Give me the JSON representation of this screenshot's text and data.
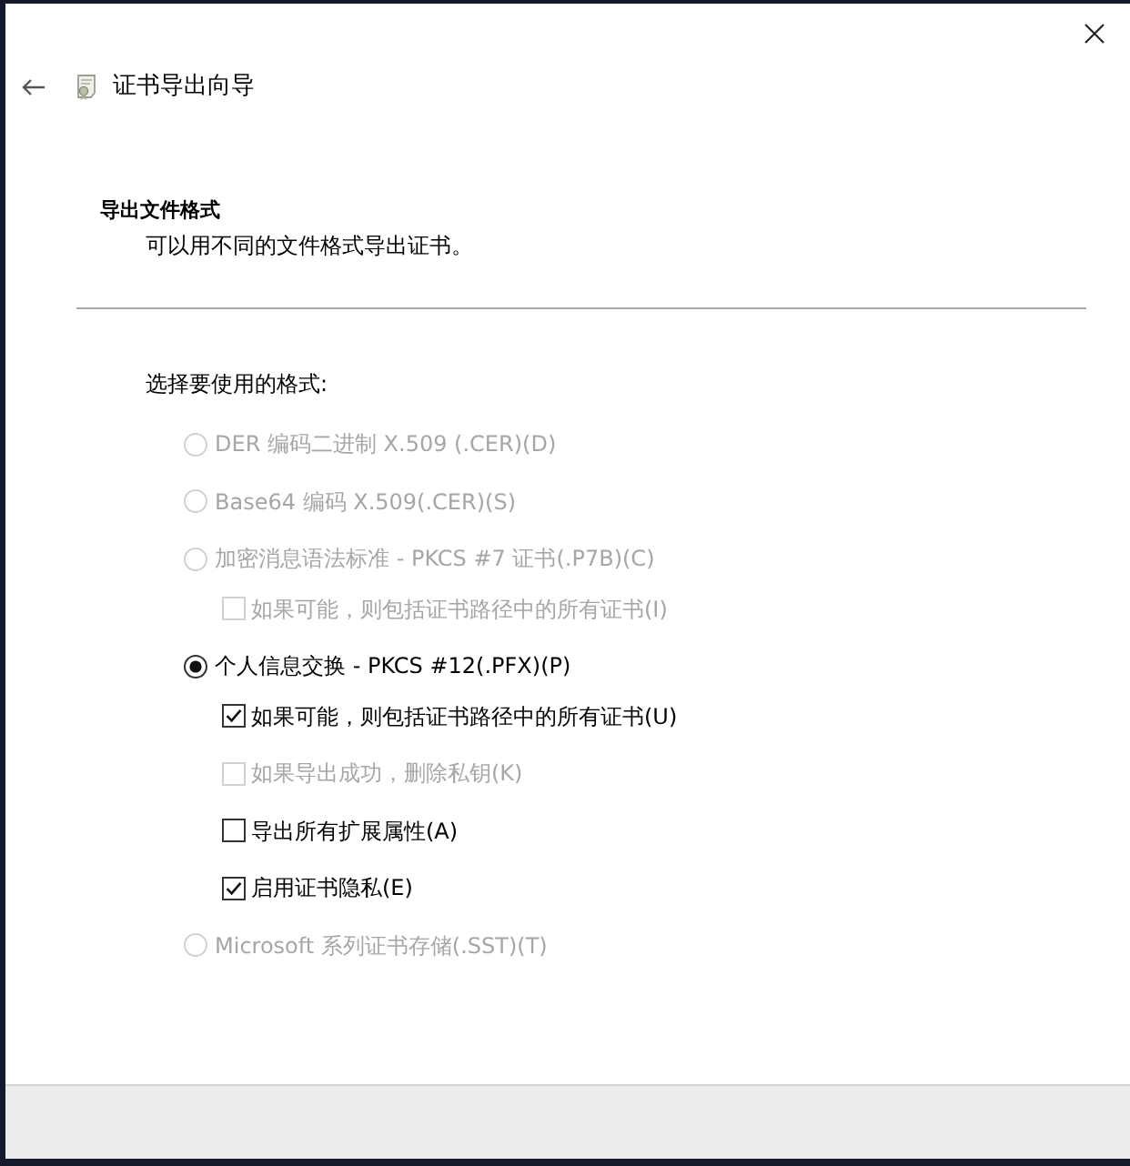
{
  "window": {
    "title": "证书导出向导"
  },
  "page": {
    "heading": "导出文件格式",
    "description": "可以用不同的文件格式导出证书。"
  },
  "format_group": {
    "label": "选择要使用的格式:",
    "options": [
      {
        "label": "DER 编码二进制 X.509 (.CER)(D)",
        "selected": false,
        "disabled": true
      },
      {
        "label": "Base64 编码 X.509(.CER)(S)",
        "selected": false,
        "disabled": true
      },
      {
        "label": "加密消息语法标准 - PKCS #7 证书(.P7B)(C)",
        "selected": false,
        "disabled": true,
        "children": [
          {
            "label": "如果可能，则包括证书路径中的所有证书(I)",
            "checked": false,
            "disabled": true
          }
        ]
      },
      {
        "label": "个人信息交换 - PKCS #12(.PFX)(P)",
        "selected": true,
        "disabled": false,
        "children": [
          {
            "label": "如果可能，则包括证书路径中的所有证书(U)",
            "checked": true,
            "disabled": false
          },
          {
            "label": "如果导出成功，删除私钥(K)",
            "checked": false,
            "disabled": true
          },
          {
            "label": "导出所有扩展属性(A)",
            "checked": false,
            "disabled": false
          },
          {
            "label": "启用证书隐私(E)",
            "checked": true,
            "disabled": false
          }
        ]
      },
      {
        "label": "Microsoft 系列证书存储(.SST)(T)",
        "selected": false,
        "disabled": true
      }
    ]
  }
}
